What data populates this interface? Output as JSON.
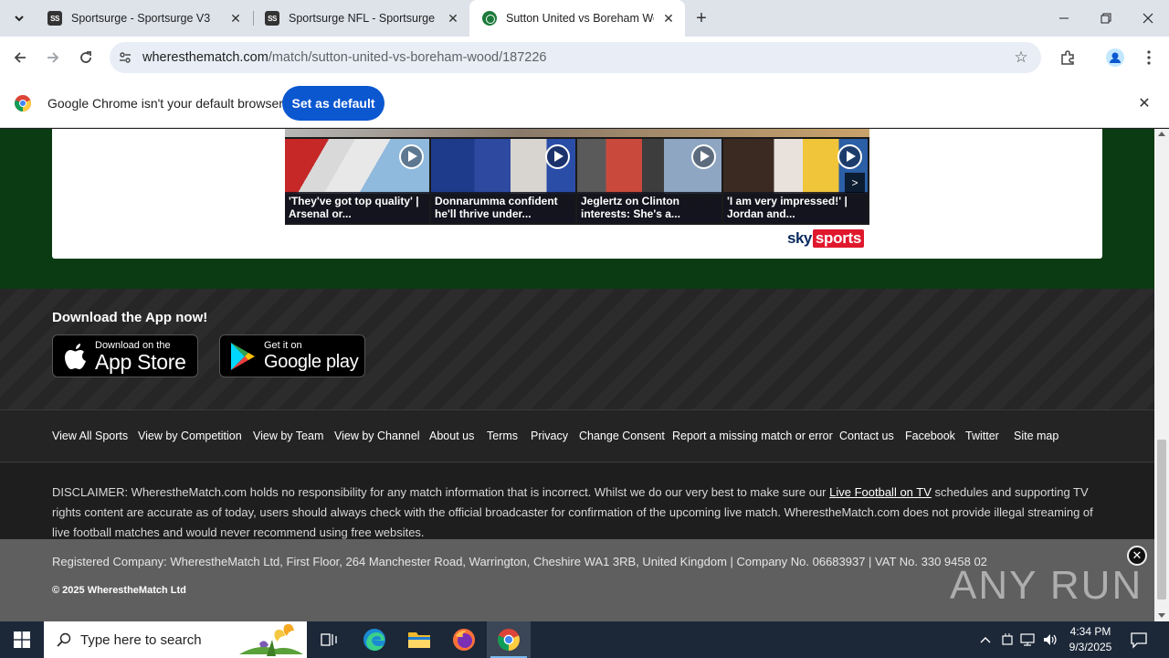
{
  "browser": {
    "tabs": [
      {
        "title": "Sportsurge - Sportsurge V3",
        "favicon": "sportsurge-icon",
        "active": false
      },
      {
        "title": "Sportsurge NFL - Sportsurge",
        "favicon": "sportsurge-icon",
        "active": false
      },
      {
        "title": "Sutton United vs Boreham Woo",
        "favicon": "wheresthematch-icon",
        "active": true
      }
    ],
    "url_domain": "wheresthematch.com",
    "url_path": "/match/sutton-united-vs-boreham-wood/187226"
  },
  "infobar": {
    "message": "Google Chrome isn't your default browser",
    "button": "Set as default"
  },
  "videos": [
    {
      "caption": "'They've got top quality' | Arsenal or..."
    },
    {
      "caption": "Donnarumma confident he'll thrive under..."
    },
    {
      "caption": "Jeglertz on Clinton interests: She's a..."
    },
    {
      "caption": "'I am very impressed!' | Jordan and..."
    }
  ],
  "next_arrow": ">",
  "sky_logo": {
    "sky": "sky",
    "sports": "sports"
  },
  "app_section": {
    "title": "Download the App now!",
    "app_store_small": "Download on the",
    "app_store_big": "App Store",
    "google_play_small": "Get it on",
    "google_play_big": "Google play"
  },
  "footer_links": [
    "View All Sports",
    "View by Competition",
    "View by Team",
    "View by Channel",
    "About us",
    "Terms",
    "Privacy",
    "Change Consent",
    "Report a missing match or error",
    "Contact us",
    "Facebook",
    "Twitter",
    "Site map"
  ],
  "disclaimer": {
    "before_link": "DISCLAIMER: WherestheMatch.com holds no responsibility for any match information that is incorrect. Whilst we do our very best to make sure our ",
    "link": "Live Football on TV",
    "after_link": " schedules and supporting TV rights content are accurate as of today, users should always check with the official broadcaster for confirmation of the upcoming live match. WherestheMatch.com does not provide illegal streaming of live football matches and would never recommend using free websites."
  },
  "registered": "Registered Company: WherestheMatch Ltd, First Floor, 264 Manchester Road, Warrington, Cheshire WA1 3RB, United Kingdom | Company No. 06683937 | VAT No. 330 9458 02",
  "copyright": "© 2025 WherestheMatch Ltd",
  "watermark": "ANY RUN",
  "taskbar": {
    "search_placeholder": "Type here to search",
    "time": "4:34 PM",
    "date": "9/3/2025"
  },
  "colors": {
    "accent_blue": "#0b57d0",
    "page_green": "#0b3b12",
    "sky_red": "#e0182d",
    "taskbar": "#1c2838"
  }
}
